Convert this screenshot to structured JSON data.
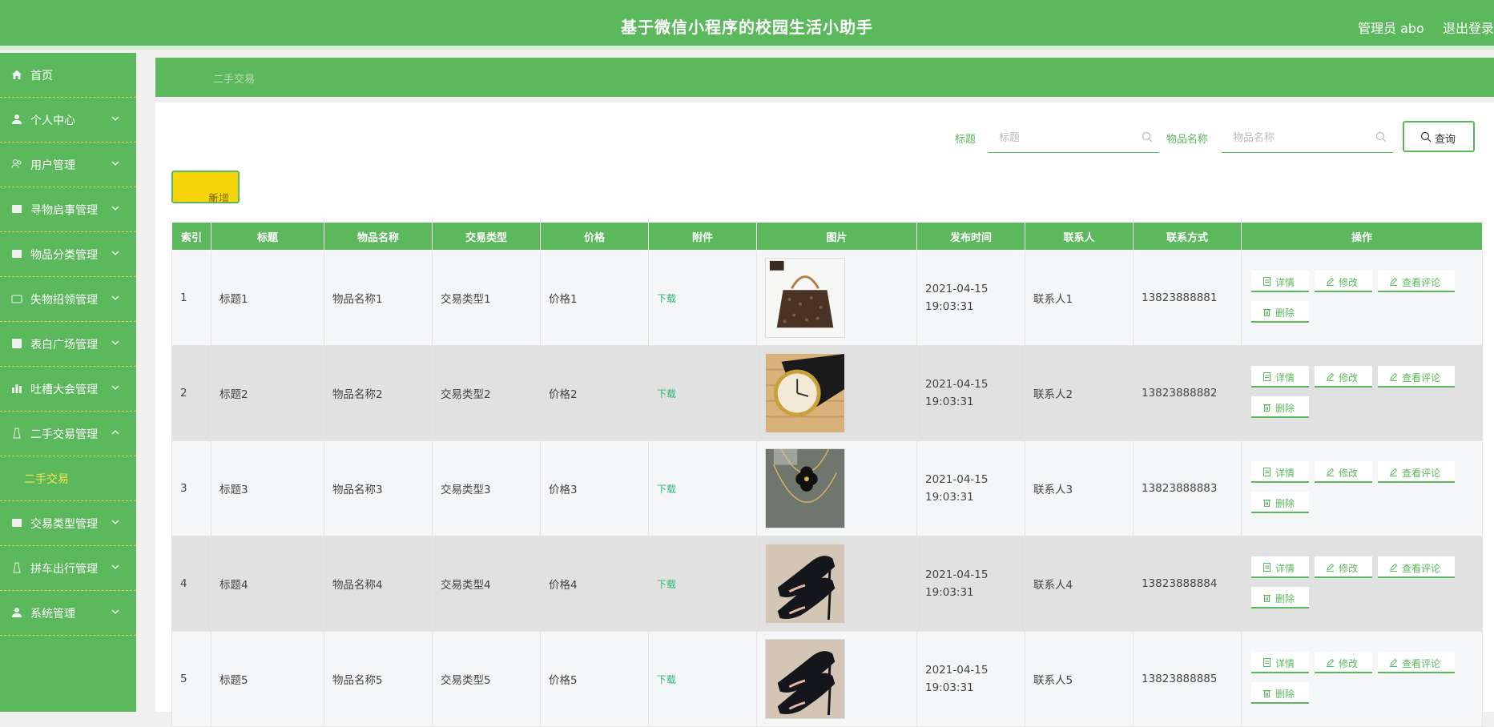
{
  "header": {
    "title": "基于微信小程序的校园生活小助手",
    "user": "管理员 abo",
    "logout": "退出登录"
  },
  "sidebar": {
    "items": [
      {
        "label": "首页",
        "icon": "home-icon"
      },
      {
        "label": "个人中心",
        "icon": "user-icon"
      },
      {
        "label": "用户管理",
        "icon": "users-icon"
      },
      {
        "label": "寻物启事管理",
        "icon": "search-doc-icon"
      },
      {
        "label": "物品分类管理",
        "icon": "category-icon"
      },
      {
        "label": "失物招领管理",
        "icon": "box-icon"
      },
      {
        "label": "表白广场管理",
        "icon": "heart-icon"
      },
      {
        "label": "吐槽大会管理",
        "icon": "chart-icon"
      },
      {
        "label": "二手交易管理",
        "icon": "trade-icon"
      },
      {
        "label": "交易类型管理",
        "icon": "tag-icon"
      },
      {
        "label": "拼车出行管理",
        "icon": "car-icon"
      },
      {
        "label": "系统管理",
        "icon": "settings-icon"
      }
    ],
    "active_sub": "二手交易"
  },
  "breadcrumb": "二手交易",
  "search": {
    "title_label": "标题",
    "title_placeholder": "标题",
    "name_label": "物品名称",
    "name_placeholder": "物品名称",
    "query_button": "查询"
  },
  "toolbar": {
    "add_button": "新增"
  },
  "table": {
    "columns": [
      "索引",
      "标题",
      "物品名称",
      "交易类型",
      "价格",
      "附件",
      "图片",
      "发布时间",
      "联系人",
      "联系方式",
      "操作"
    ],
    "rows": [
      {
        "index": "1",
        "title": "标题1",
        "name": "物品名称1",
        "type": "交易类型1",
        "price": "价格1",
        "attachment": "下载",
        "image": "handbag",
        "time": "2021-04-15 19:03:31",
        "contact": "联系人1",
        "phone": "13823888881"
      },
      {
        "index": "2",
        "title": "标题2",
        "name": "物品名称2",
        "type": "交易类型2",
        "price": "价格2",
        "attachment": "下载",
        "image": "watch",
        "time": "2021-04-15 19:03:31",
        "contact": "联系人2",
        "phone": "13823888882"
      },
      {
        "index": "3",
        "title": "标题3",
        "name": "物品名称3",
        "type": "交易类型3",
        "price": "价格3",
        "attachment": "下载",
        "image": "necklace",
        "time": "2021-04-15 19:03:31",
        "contact": "联系人3",
        "phone": "13823888883"
      },
      {
        "index": "4",
        "title": "标题4",
        "name": "物品名称4",
        "type": "交易类型4",
        "price": "价格4",
        "attachment": "下载",
        "image": "heels",
        "time": "2021-04-15 19:03:31",
        "contact": "联系人4",
        "phone": "13823888884"
      },
      {
        "index": "5",
        "title": "标题5",
        "name": "物品名称5",
        "type": "交易类型5",
        "price": "价格5",
        "attachment": "下载",
        "image": "heels",
        "time": "2021-04-15 19:03:31",
        "contact": "联系人5",
        "phone": "13823888885"
      }
    ],
    "actions": {
      "detail": "详情",
      "edit": "修改",
      "comments": "查看评论",
      "delete": "删除"
    }
  },
  "colors": {
    "primary": "#5cb85c",
    "accent": "#f7d50a",
    "link": "#2bb673"
  }
}
